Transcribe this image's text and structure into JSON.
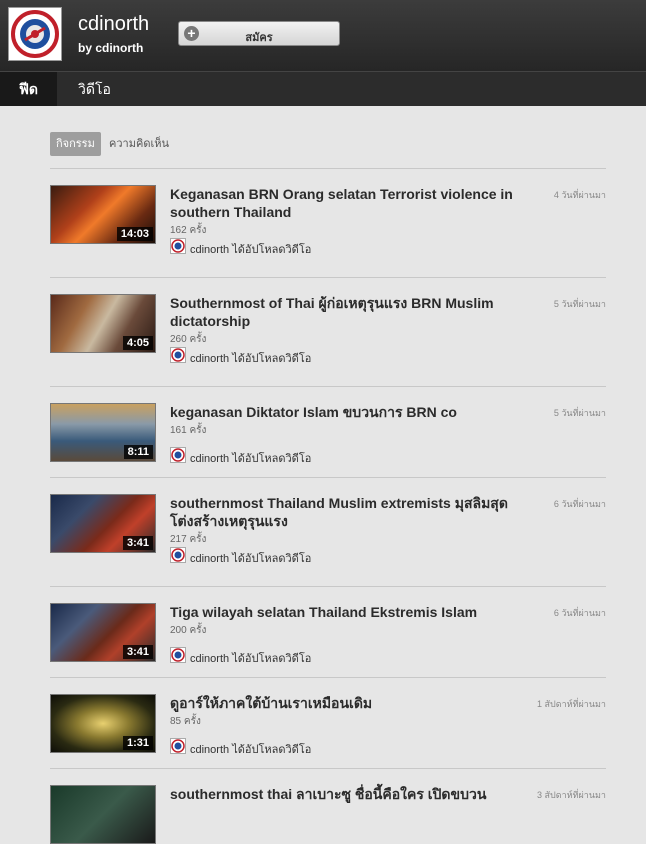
{
  "header": {
    "channel_name": "cdinorth",
    "by_line": "by cdinorth",
    "subscribe_label": "สมัคร"
  },
  "nav": {
    "feed": "ฟีด",
    "videos": "วิดีโอ"
  },
  "filters": {
    "activity": "กิจกรรม",
    "comments": "ความคิดเห็น"
  },
  "items": [
    {
      "title": "Keganasan BRN Orang selatan Terrorist violence in southern Thailand",
      "views": "162 ครั้ง",
      "uploader": "cdinorth ได้อัปโหลดวิดีโอ",
      "time": "4 วันที่ผ่านมา",
      "duration": "14:03"
    },
    {
      "title": "Southernmost of Thai ผู้ก่อเหตุรุนแรง BRN Muslim dictatorship",
      "views": "260 ครั้ง",
      "uploader": "cdinorth ได้อัปโหลดวิดีโอ",
      "time": "5 วันที่ผ่านมา",
      "duration": "4:05"
    },
    {
      "title": "keganasan Diktator Islam ขบวนการ BRN co",
      "views": "161 ครั้ง",
      "uploader": "cdinorth ได้อัปโหลดวิดีโอ",
      "time": "5 วันที่ผ่านมา",
      "duration": "8:11"
    },
    {
      "title": "southernmost Thailand Muslim extremists มุสลิมสุดโต่งสร้างเหตุรุนแรง",
      "views": "217 ครั้ง",
      "uploader": "cdinorth ได้อัปโหลดวิดีโอ",
      "time": "6 วันที่ผ่านมา",
      "duration": "3:41"
    },
    {
      "title": "Tiga wilayah selatan Thailand Ekstremis Islam",
      "views": "200 ครั้ง",
      "uploader": "cdinorth ได้อัปโหลดวิดีโอ",
      "time": "6 วันที่ผ่านมา",
      "duration": "3:41"
    },
    {
      "title": "ดูอาร์ให้ภาคใต้บ้านเราเหมือนเดิม",
      "views": "85 ครั้ง",
      "uploader": "cdinorth ได้อัปโหลดวิดีโอ",
      "time": "1 สัปดาห์ที่ผ่านมา",
      "duration": "1:31"
    },
    {
      "title": "southernmost thai ลาเบาะซู ชื่อนี้คือใคร เปิดขบวน",
      "views": "",
      "uploader": "",
      "time": "3 สัปดาห์ที่ผ่านมา",
      "duration": ""
    }
  ]
}
